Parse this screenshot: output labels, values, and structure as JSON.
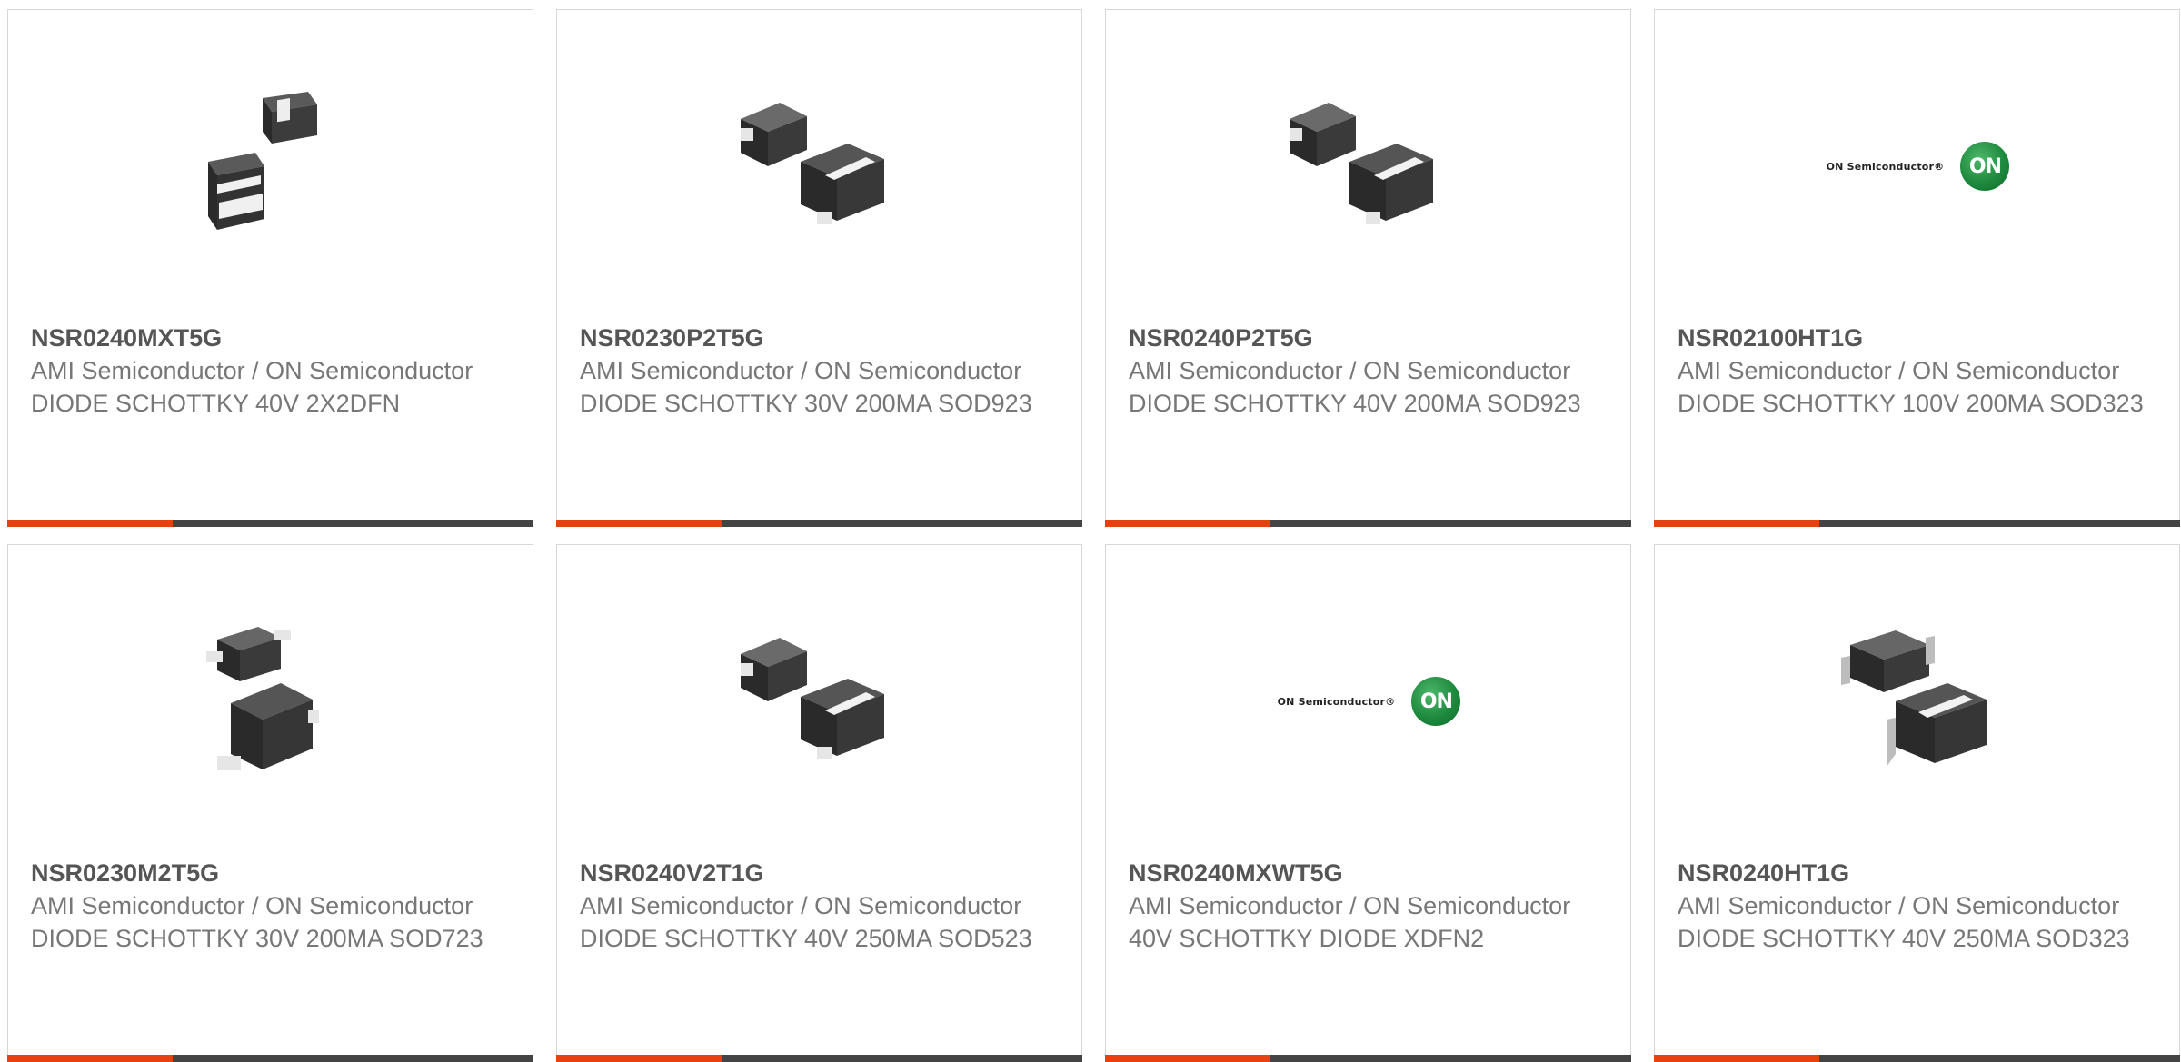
{
  "cards": [
    {
      "part_number": "NSR0240MXT5G",
      "manufacturer": "AMI Semiconductor / ON Semiconductor",
      "description": "DIODE SCHOTTKY 40V 2X2DFN",
      "image": "dfn-diode-package-image"
    },
    {
      "part_number": "NSR0230P2T5G",
      "manufacturer": "AMI Semiconductor / ON Semiconductor",
      "description": "DIODE SCHOTTKY 30V 200MA SOD923",
      "image": "sod-diode-package-image"
    },
    {
      "part_number": "NSR0240P2T5G",
      "manufacturer": "AMI Semiconductor / ON Semiconductor",
      "description": "DIODE SCHOTTKY 40V 200MA SOD923",
      "image": "sod-diode-package-image"
    },
    {
      "part_number": "NSR02100HT1G",
      "manufacturer": "AMI Semiconductor / ON Semiconductor",
      "description": "DIODE SCHOTTKY 100V 200MA SOD323",
      "image": "on-semiconductor-logo",
      "logo_text": "ON Semiconductor®",
      "logo_mark": "ON"
    },
    {
      "part_number": "NSR0230M2T5G",
      "manufacturer": "AMI Semiconductor / ON Semiconductor",
      "description": "DIODE SCHOTTKY 30V 200MA SOD723",
      "image": "sod723-diode-package-image"
    },
    {
      "part_number": "NSR0240V2T1G",
      "manufacturer": "AMI Semiconductor / ON Semiconductor",
      "description": "DIODE SCHOTTKY 40V 250MA SOD523",
      "image": "sod-diode-package-image"
    },
    {
      "part_number": "NSR0240MXWT5G",
      "manufacturer": "AMI Semiconductor / ON Semiconductor",
      "description": "40V SCHOTTKY DIODE XDFN2",
      "image": "on-semiconductor-logo",
      "logo_text": "ON Semiconductor®",
      "logo_mark": "ON"
    },
    {
      "part_number": "NSR0240HT1G",
      "manufacturer": "AMI Semiconductor / ON Semiconductor",
      "description": "DIODE SCHOTTKY 40V 250MA SOD323",
      "image": "sod323-diode-package-image"
    }
  ],
  "colors": {
    "accent": "#e8400e",
    "bar": "#444444",
    "part_number": "#555555",
    "text": "#777777",
    "on_green": "#1e8a3e"
  }
}
